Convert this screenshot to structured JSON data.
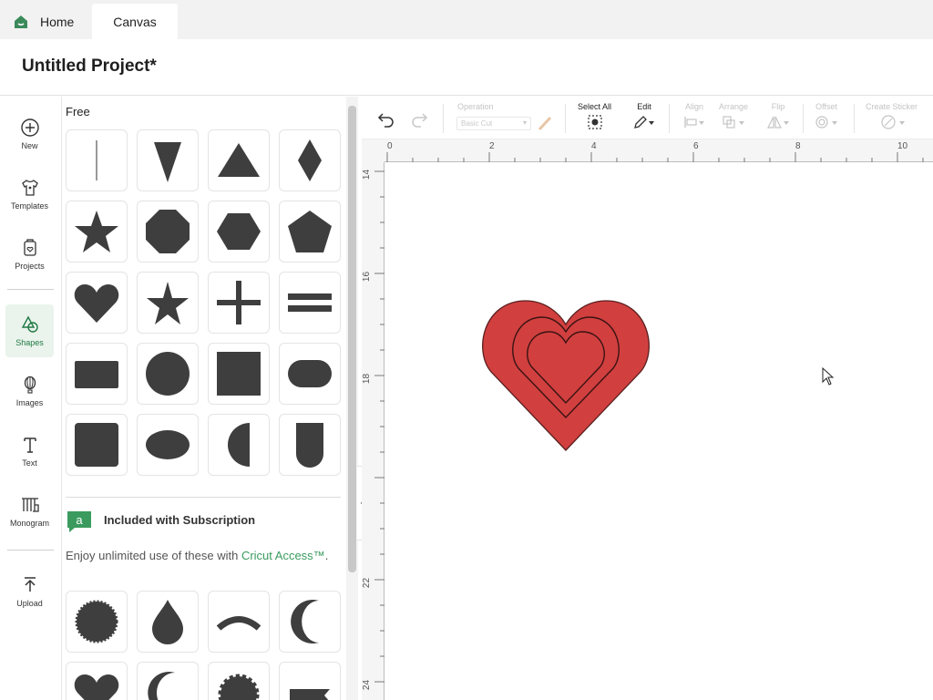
{
  "tabs": {
    "home_label": "Home",
    "canvas_label": "Canvas"
  },
  "project": {
    "title": "Untitled Project*"
  },
  "leftnav": [
    {
      "label": "New",
      "icon": "plus-circle-icon"
    },
    {
      "label": "Templates",
      "icon": "shirt-icon"
    },
    {
      "label": "Projects",
      "icon": "projects-icon"
    },
    {
      "label": "Shapes",
      "icon": "shapes-icon",
      "active": true
    },
    {
      "label": "Images",
      "icon": "balloon-icon"
    },
    {
      "label": "Text",
      "icon": "text-icon"
    },
    {
      "label": "Monogram",
      "icon": "monogram-icon"
    },
    {
      "label": "Upload",
      "icon": "upload-icon"
    }
  ],
  "panel": {
    "free_heading": "Free",
    "free_shapes": [
      "line",
      "triangle-down",
      "triangle",
      "diamond",
      "star",
      "octagon",
      "hexagon",
      "pentagon",
      "heart",
      "star-thin",
      "plus",
      "equals",
      "rectangle",
      "circle",
      "square",
      "rounded-rectangle",
      "square-rounded",
      "oval",
      "half-circle",
      "shield"
    ],
    "subscription_heading": "Included with Subscription",
    "subscription_desc": "Enjoy unlimited use of these with ",
    "subscription_link": "Cricut Access™",
    "subscription_period": ".",
    "subscription_shapes": [
      "scalloped-circle",
      "teardrop",
      "arc",
      "crescent",
      "heart",
      "crescent-thin",
      "scalloped-circle-2",
      "banner"
    ]
  },
  "toolbar": {
    "operation_label": "Operation",
    "operation_value": "Basic Cut",
    "select_all_label": "Select All",
    "edit_label": "Edit",
    "align_label": "Align",
    "arrange_label": "Arrange",
    "flip_label": "Flip",
    "offset_label": "Offset",
    "create_sticker_label": "Create Sticker"
  },
  "rulers": {
    "top": [
      "0",
      "2",
      "4",
      "6",
      "8",
      "10"
    ],
    "left": [
      "14",
      "16",
      "18",
      "22",
      "24"
    ]
  },
  "colors": {
    "heart_fill": "#d13f3f",
    "accent": "#1f7a44",
    "link": "#3b9b5f",
    "shape_fill": "#3e3e3e"
  }
}
